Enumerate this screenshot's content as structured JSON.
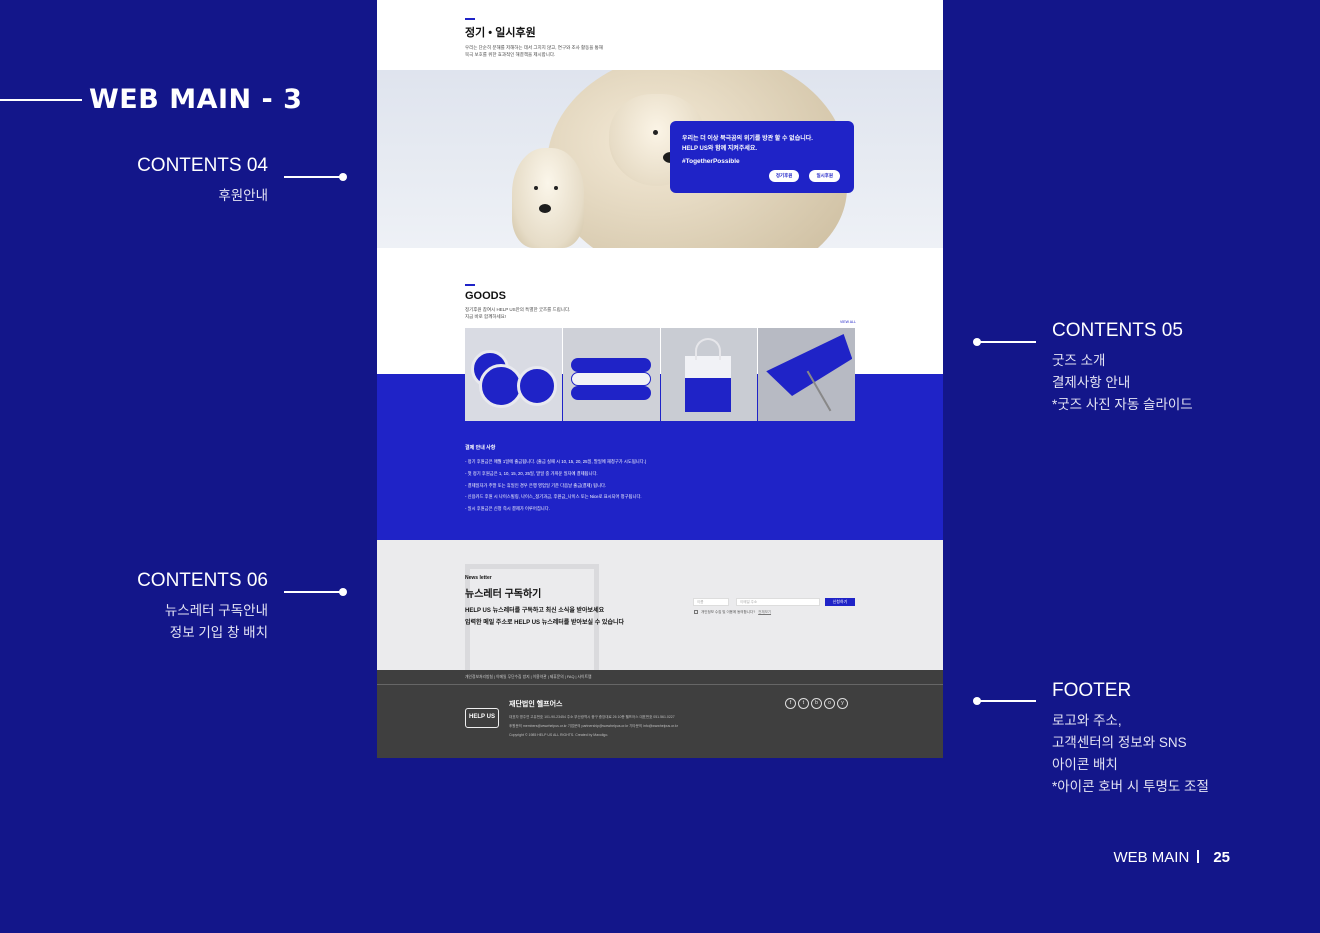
{
  "header": {
    "title": "WEB MAIN - 3"
  },
  "annotations": {
    "c04": {
      "heading": "CONTENTS 04",
      "lines": [
        "후원안내"
      ]
    },
    "c05": {
      "heading": "CONTENTS 05",
      "lines": [
        "굿즈 소개",
        "결제사항 안내",
        "*굿즈 사진 자동 슬라이드"
      ]
    },
    "c06": {
      "heading": "CONTENTS 06",
      "lines": [
        "뉴스레터 구독안내",
        "정보 기입 창 배치"
      ]
    },
    "footer": {
      "heading": "FOOTER",
      "lines": [
        "로고와 주소,",
        "고객센터의 정보와 SNS",
        "아이콘 배치",
        "*아이콘 호버 시 투명도 조절"
      ]
    }
  },
  "page": {
    "label": "WEB MAIN",
    "number": "25"
  },
  "mockup": {
    "donation": {
      "title": "정기 • 일시후원",
      "desc1": "우리는 단순히 분해를 저해하는 데서 그치지 않고, 연구와 조사 활동을 통해",
      "desc2": "북극 보호를 위한 효과적인 해결책을 제시합니다.",
      "card_line1": "우리는 더 이상 북극곰의 위기를 방관 할 수 없습니다.",
      "card_line2": "HELP US와 함께 지켜주세요.",
      "hashtag": "#TogetherPossible",
      "btn_regular": "정기후원",
      "btn_once": "일시후원"
    },
    "goods": {
      "title": "GOODS",
      "desc1": "정기후원 참여시 HELP US만의 특별한 굿즈를 드립니다.",
      "desc2": "지금 바로 함께하세요!",
      "view_all": "VIEW ALL",
      "items": [
        "HELP US",
        "HELP US",
        "HELP US",
        "HELP US"
      ]
    },
    "payment": {
      "heading": "결제 안내 사항",
      "items": [
        "- 정기 후원금은 매월 1일에 출금됩니다. (출금 실패 시 10, 15, 20, 25일, 말일에 재청구가 시도됩니다.)",
        "- 첫 정기 후원금은 1, 10, 15, 20, 25일, 말일 중 가까운 일자에 결제됩니다.",
        "- 결제일자가 주말 또는 휴일인 경우 은행 영업일 기준 다음날 출금(결제) 됩니다.",
        "- 신용카드 후원 시 나이스빌링, 나이스_정기과금, 후원금_나이스 또는 Nice로 표시되어 청구됩니다.",
        "- 일시 후원금은 신청 즉시 결제가 이루어집니다."
      ]
    },
    "newsletter": {
      "kicker": "News letter",
      "title": "뉴스레터 구독하기",
      "desc1": "HELP US 뉴스레터를 구독하고 최신 소식을 받아보세요",
      "desc2": "입력한 메일 주소로 HELP US 뉴스레터를 받아보실 수 있습니다",
      "name_placeholder": "이름",
      "email_placeholder": "이메일 주소",
      "submit": "신청하기",
      "agree": "개인정보 수집 및 이용에 동의합니다?",
      "agree_more": "전체보기"
    },
    "footer": {
      "links": "개인정보처리방침  |  이메일 무단수집 방지  |  이용약관  |  제휴문의  |  FAQ  |  사이트맵",
      "logo": "HELP US",
      "org": "재단법인 헬프어스",
      "info1": "대표자 명주연    고유번호 101-90-23454    주소 부산광역시 중구 중앙대로 26 10층 헬프어스    대표번호 051.561.0227",
      "info2": "후원문의 members@wwwhelpus.or.kr    기업문의 partnership@wwwhelpus.or.kr    기타문의 info@wwwhelpus.or.kr",
      "copyright": "Copyright © 1985 HELP US ALL RIGHTS. Created by Maxoligo.",
      "sns": [
        "f",
        "t",
        "b",
        "o",
        "y"
      ]
    }
  }
}
